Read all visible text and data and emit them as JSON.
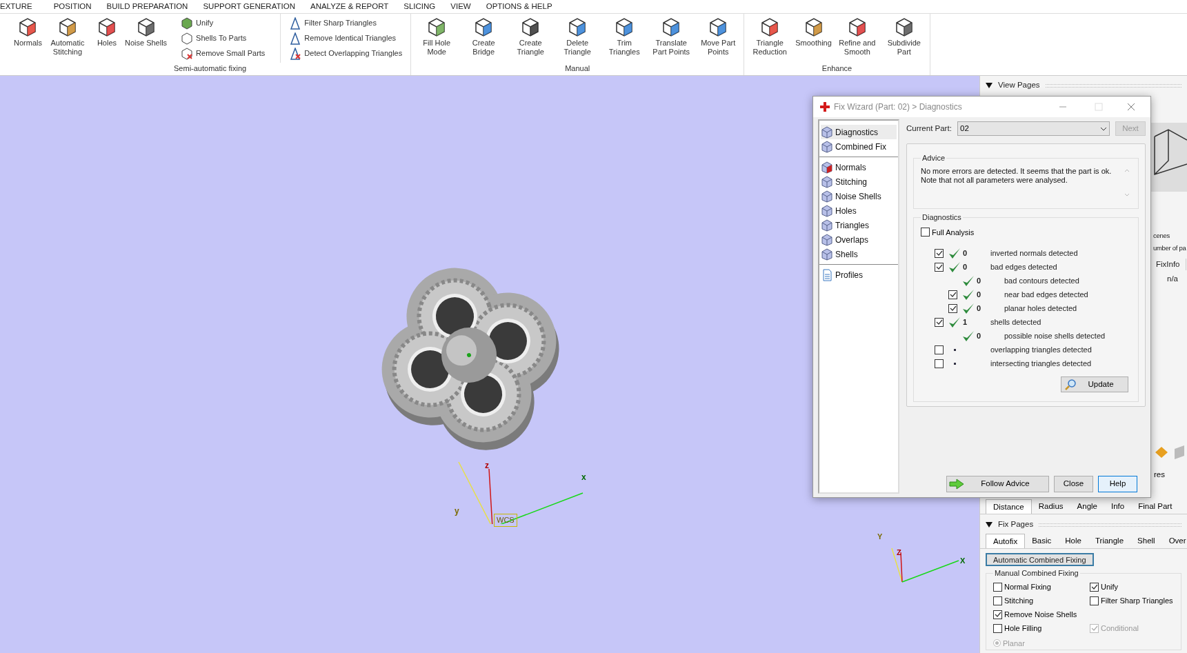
{
  "menu": [
    {
      "label": "EXTURE"
    },
    {
      "label": "POSITION"
    },
    {
      "label": "BUILD PREPARATION"
    },
    {
      "label": "SUPPORT GENERATION"
    },
    {
      "label": "ANALYZE & REPORT"
    },
    {
      "label": "SLICING"
    },
    {
      "label": "VIEW"
    },
    {
      "label": "OPTIONS & HELP"
    }
  ],
  "ribbon": {
    "groups": [
      {
        "label": "Semi-automatic fixing",
        "large_buttons": [
          {
            "label": "Normals"
          },
          {
            "label": "Automatic Stitching"
          },
          {
            "label": "Holes"
          },
          {
            "label": "Noise Shells"
          }
        ],
        "small_columns": [
          [
            {
              "label": "Unify"
            },
            {
              "label": "Shells To Parts"
            },
            {
              "label": "Remove Small Parts"
            }
          ],
          [
            {
              "label": "Filter Sharp Triangles"
            },
            {
              "label": "Remove Identical Triangles"
            },
            {
              "label": "Detect Overlapping Triangles"
            }
          ]
        ]
      },
      {
        "label": "Manual",
        "large_buttons": [
          {
            "label": "Fill Hole Mode"
          },
          {
            "label": "Create Bridge"
          },
          {
            "label": "Create Triangle"
          },
          {
            "label": "Delete Triangle"
          },
          {
            "label": "Trim Triangles"
          },
          {
            "label": "Translate Part Points"
          },
          {
            "label": "Move Part Points"
          }
        ]
      },
      {
        "label": "Enhance",
        "large_buttons": [
          {
            "label": "Triangle Reduction"
          },
          {
            "label": "Smoothing"
          },
          {
            "label": "Refine and Smooth"
          },
          {
            "label": "Subdivide Part"
          }
        ]
      }
    ]
  },
  "viewport": {
    "axes": {
      "x": "x",
      "y": "y",
      "z": "z",
      "label": "WCS"
    },
    "mini_axes": {
      "x": "X",
      "y": "Y",
      "z": "Z"
    }
  },
  "dialog": {
    "title": "Fix Wizard (Part: 02) > Diagnostics",
    "nav_groups": [
      [
        {
          "label": "Diagnostics",
          "selected": true
        },
        {
          "label": "Combined Fix",
          "selected": false
        }
      ],
      [
        {
          "label": "Normals",
          "selected": false
        },
        {
          "label": "Stitching",
          "selected": false
        },
        {
          "label": "Noise Shells",
          "selected": false
        },
        {
          "label": "Holes",
          "selected": false
        },
        {
          "label": "Triangles",
          "selected": false
        },
        {
          "label": "Overlaps",
          "selected": false
        },
        {
          "label": "Shells",
          "selected": false
        }
      ],
      [
        {
          "label": "Profiles",
          "selected": false
        }
      ]
    ],
    "current_part": {
      "label": "Current Part:",
      "value": "02"
    },
    "next_button": {
      "label": "Next",
      "disabled": true
    },
    "advice": {
      "title": "Advice",
      "lines": [
        "No more errors are detected. It seems that the part is ok.",
        "Note that not all parameters were analysed."
      ]
    },
    "diagnostics": {
      "title": "Diagnostics",
      "full_analysis": {
        "label": "Full Analysis",
        "checked": false
      },
      "rows": [
        {
          "kind": "checkbox",
          "checked": true,
          "passed": true,
          "count": "0",
          "label": "inverted normals detected"
        },
        {
          "kind": "checkbox",
          "checked": true,
          "passed": true,
          "count": "0",
          "label": "bad edges detected",
          "children": [
            {
              "kind": "plain",
              "passed": true,
              "count": "0",
              "label": "bad contours detected"
            },
            {
              "kind": "checkbox",
              "checked": true,
              "passed": true,
              "count": "0",
              "label": "near bad edges detected"
            },
            {
              "kind": "checkbox",
              "checked": true,
              "passed": true,
              "count": "0",
              "label": "planar holes detected"
            }
          ]
        },
        {
          "kind": "checkbox",
          "checked": true,
          "passed": true,
          "count": "1",
          "label": "shells detected",
          "children": [
            {
              "kind": "plain",
              "passed": true,
              "count": "0",
              "label": "possible noise shells detected"
            }
          ]
        },
        {
          "kind": "checkbox",
          "checked": false,
          "passed": false,
          "label": "overlapping triangles detected"
        },
        {
          "kind": "checkbox",
          "checked": false,
          "passed": false,
          "label": "intersecting triangles detected"
        }
      ],
      "update_button": "Update"
    },
    "buttons": [
      {
        "label": "Follow Advice",
        "focused": false
      },
      {
        "label": "Close",
        "focused": false
      },
      {
        "label": "Help",
        "focused": true
      }
    ]
  },
  "right_panel": {
    "view_pages": "View Pages",
    "scene_lines": [
      "cenes",
      "umber of pa"
    ],
    "table": {
      "column": "FixInfo",
      "value": "n/a"
    },
    "partial_label": "res",
    "measurement_tabs": [
      {
        "label": "Distance",
        "selected": true
      },
      {
        "label": "Radius",
        "selected": false
      },
      {
        "label": "Angle",
        "selected": false
      },
      {
        "label": "Info",
        "selected": false
      },
      {
        "label": "Final Part",
        "selected": false
      }
    ],
    "fix_pages": {
      "title": "Fix Pages",
      "tabs": [
        {
          "label": "Autofix",
          "selected": true
        },
        {
          "label": "Basic",
          "selected": false
        },
        {
          "label": "Hole",
          "selected": false
        },
        {
          "label": "Triangle",
          "selected": false
        },
        {
          "label": "Shell",
          "selected": false
        },
        {
          "label": "Over",
          "selected": false
        }
      ],
      "auto_button": "Automatic Combined Fixing",
      "group": {
        "title": "Manual Combined Fixing",
        "rows": [
          {
            "left": {
              "label": "Normal Fixing",
              "checked": false
            },
            "right": {
              "label": "Unify",
              "checked": true,
              "disabled": false
            }
          },
          {
            "left": {
              "label": "Stitching",
              "checked": false
            },
            "right": {
              "label": "Filter Sharp Triangles",
              "checked": false,
              "disabled": false
            }
          },
          {
            "left": {
              "label": "Remove Noise Shells",
              "checked": true
            }
          },
          {
            "left": {
              "label": "Hole Filling",
              "checked": false
            },
            "right": {
              "label": "Conditional",
              "checked": true,
              "disabled": true
            }
          }
        ],
        "planar": {
          "label": "Planar",
          "selected": true,
          "disabled": true
        }
      }
    }
  }
}
